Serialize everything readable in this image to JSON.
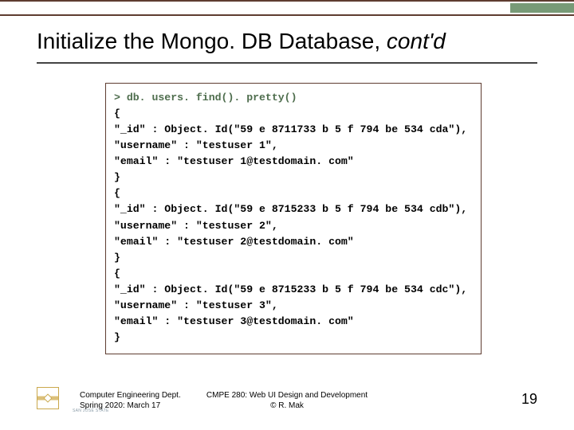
{
  "title": {
    "main": "Initialize the Mongo. DB Database, ",
    "italic": "cont'd"
  },
  "code": {
    "prompt": "> db. users. find(). pretty()",
    "body": "{\n\"_id\" : Object. Id(\"59 e 8711733 b 5 f 794 be 534 cda\"),\n\"username\" : \"testuser 1\",\n\"email\" : \"testuser 1@testdomain. com\"\n}\n{\n\"_id\" : Object. Id(\"59 e 8715233 b 5 f 794 be 534 cdb\"),\n\"username\" : \"testuser 2\",\n\"email\" : \"testuser 2@testdomain. com\"\n}\n{\n\"_id\" : Object. Id(\"59 e 8715233 b 5 f 794 be 534 cdc\"),\n\"username\" : \"testuser 3\",\n\"email\" : \"testuser 3@testdomain. com\"\n}"
  },
  "footer": {
    "left_line1": "Computer Engineering Dept.",
    "left_line2": "Spring 2020: March 17",
    "center_line1": "CMPE 280: Web UI Design and Development",
    "center_line2": "© R. Mak",
    "page": "19",
    "logo_label": "SAN JOSÉ STATE"
  }
}
